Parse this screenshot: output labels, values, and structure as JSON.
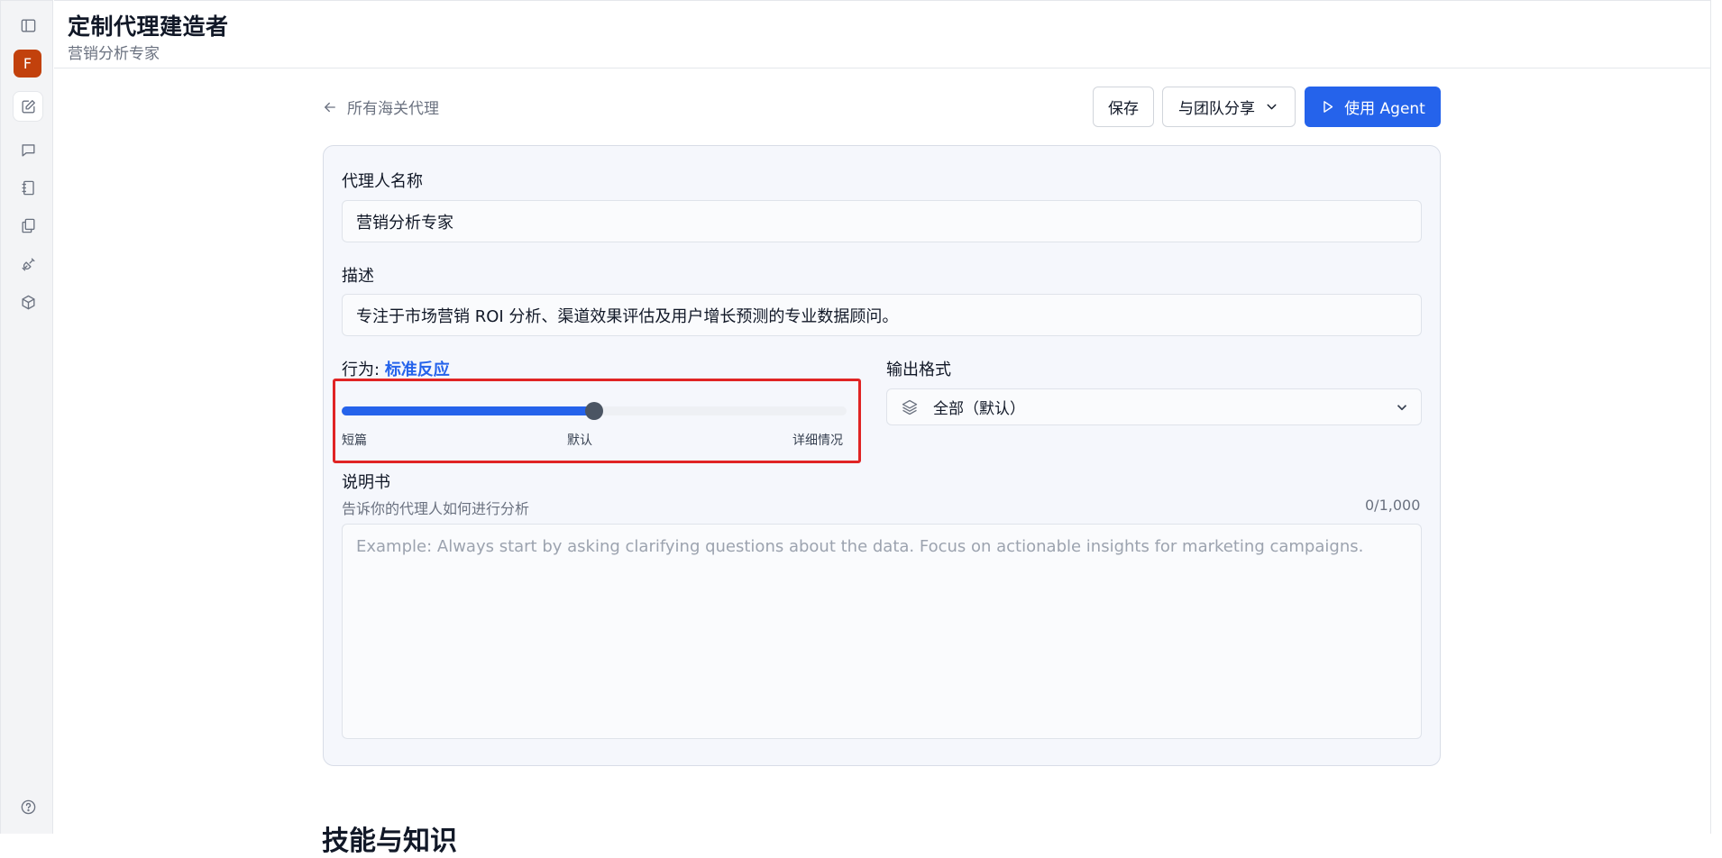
{
  "app": {
    "title": "定制代理建造者",
    "subtitle": "营销分析专家"
  },
  "sidebar": {
    "avatar_letter": "F",
    "icons": [
      "sidebar-toggle-icon",
      "edit-icon",
      "chat-icon",
      "notebook-icon",
      "files-icon",
      "plug-icon",
      "cube-icon",
      "help-icon"
    ]
  },
  "nav": {
    "back_label": "所有海关代理"
  },
  "toolbar": {
    "save_label": "保存",
    "share_label": "与团队分享",
    "use_label": "使用 Agent"
  },
  "form": {
    "name_label": "代理人名称",
    "name_value": "营销分析专家",
    "desc_label": "描述",
    "desc_value": "专注于市场营销 ROI 分析、渠道效果评估及用户增长预测的专业数据顾问。",
    "behavior_prefix": "行为:",
    "behavior_value": "标准反应",
    "slider": {
      "min_label": "短篇",
      "mid_label": "默认",
      "max_label": "详细情况",
      "level": 0.5
    },
    "format_label": "输出格式",
    "format_value": "全部（默认）",
    "instructions_label": "说明书",
    "instructions_hint": "告诉你的代理人如何进行分析",
    "instructions_count": "0/1,000",
    "instructions_placeholder": "Example: Always start by asking clarifying questions about the data. Focus on actionable insights for marketing campaigns."
  },
  "section": {
    "title": "技能与知识"
  },
  "colors": {
    "accent": "#2563eb",
    "highlight_border": "#e02424",
    "avatar": "#c2410c"
  }
}
